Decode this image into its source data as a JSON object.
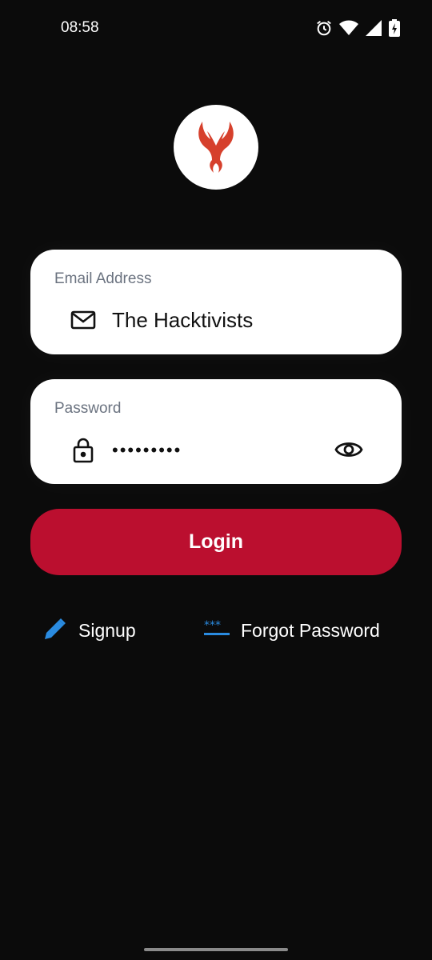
{
  "status_bar": {
    "time": "08:58",
    "icons": [
      "alarm-icon",
      "wifi-icon",
      "signal-icon",
      "battery-charging-icon"
    ]
  },
  "logo": {
    "icon": "devil-horns-logo",
    "color": "#d6402c"
  },
  "email": {
    "label": "Email Address",
    "icon": "mail-icon",
    "value": "The Hacktivists"
  },
  "password": {
    "label": "Password",
    "icon": "lock-icon",
    "value": "•••••••••",
    "toggle_icon": "eye-icon"
  },
  "login": {
    "label": "Login",
    "color": "#bb0f2f"
  },
  "links": {
    "signup": {
      "label": "Signup",
      "icon": "pencil-icon"
    },
    "forgot": {
      "label": "Forgot Password",
      "icon": "password-dots-icon"
    },
    "accent": "#2a8be0"
  }
}
